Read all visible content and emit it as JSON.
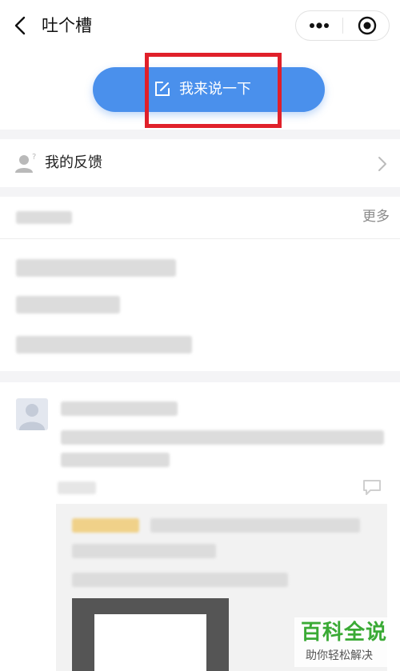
{
  "header": {
    "title": "吐个槽",
    "back_icon": "chevron-left-icon",
    "more_icon": "more-dots-icon",
    "close_icon": "target-icon"
  },
  "hero": {
    "cta_label": "我来说一下",
    "cta_icon": "edit-icon",
    "accent_color": "#4a90ec",
    "highlight_color": "#e0202a"
  },
  "feedback": {
    "label": "我的反馈",
    "icon": "user-question-icon",
    "arrow_icon": "chevron-right-icon"
  },
  "faq": {
    "more_label": "更多"
  },
  "watermark": {
    "title": "百科全说",
    "subtitle": "助你轻松解决"
  }
}
